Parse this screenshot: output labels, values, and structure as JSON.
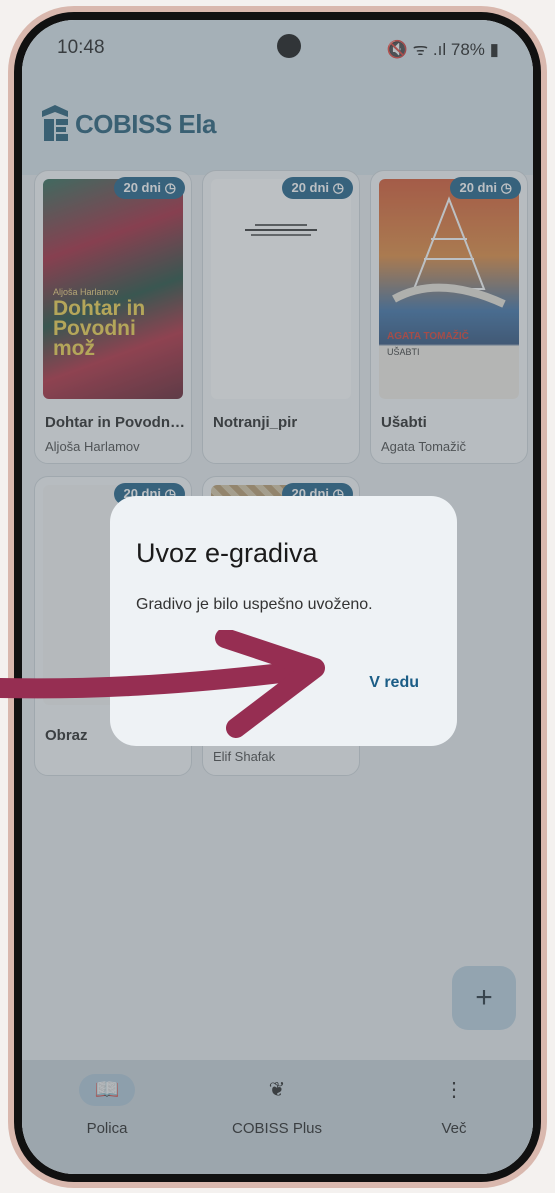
{
  "status": {
    "time": "10:48",
    "battery": "78%",
    "icons": "🔇 ᯤ .ıl"
  },
  "app": {
    "name": "COBISS Ela"
  },
  "books": [
    {
      "title": "Dohtar in Povodni...",
      "author": "Aljoša Harlamov",
      "badge": "20 dni ◷",
      "cover_title": "Dohtar in Povodni mož",
      "cover_author": "Aljoša Harlamov",
      "cover_color": "#9b2d3a"
    },
    {
      "title": "Notranji_pir",
      "author": "",
      "badge": "20 dni ◷",
      "cover_color": "#ffffff"
    },
    {
      "title": "Ušabti",
      "author": "Agata Tomažič",
      "badge": "20 dni ◷",
      "cover_title": "UŠABTI",
      "cover_author": "AGATA TOMAŽIČ",
      "cover_color": "#d0532f"
    },
    {
      "title": "Obraz",
      "author": "",
      "badge": "20 dni ◷",
      "cover_color": "#f3f3f3"
    },
    {
      "title": "",
      "author": "Elif Shafak",
      "badge": "20 dni ◷",
      "cover_color": "#b9996b"
    }
  ],
  "dialog": {
    "title": "Uvoz e-gradiva",
    "message": "Gradivo je bilo uspešno uvoženo.",
    "button": "V redu"
  },
  "fab": {
    "label": "+"
  },
  "nav": [
    {
      "label": "Polica",
      "icon": "book-icon",
      "glyph": "📖"
    },
    {
      "label": "COBISS Plus",
      "icon": "cobiss-plus-icon",
      "glyph": "❦"
    },
    {
      "label": "Več",
      "icon": "more-vertical-icon",
      "glyph": "⋮"
    }
  ],
  "colors": {
    "accent": "#1b5d86",
    "arrow": "#962e52"
  }
}
